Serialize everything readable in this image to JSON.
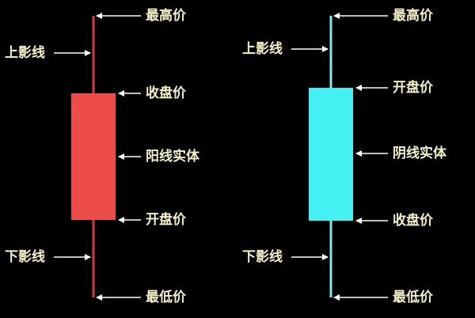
{
  "colors": {
    "background": "#000000",
    "yang_body": "#ee4b4b",
    "yang_wick": "#d43c3c",
    "yin_body": "#45f0f2",
    "yin_wick": "#7fe9ee",
    "arrow": "#ffffff",
    "text": "#f4f1c6"
  },
  "yang_candle": {
    "high_label": "最高价",
    "upper_shadow_label": "上影线",
    "close_label": "收盘价",
    "body_label": "阳线实体",
    "open_label": "开盘价",
    "lower_shadow_label": "下影线",
    "low_label": "最低价"
  },
  "yin_candle": {
    "high_label": "最高价",
    "upper_shadow_label": "上影线",
    "open_label": "开盘价",
    "body_label": "阴线实体",
    "close_label": "收盘价",
    "lower_shadow_label": "下影线",
    "low_label": "最低价"
  }
}
